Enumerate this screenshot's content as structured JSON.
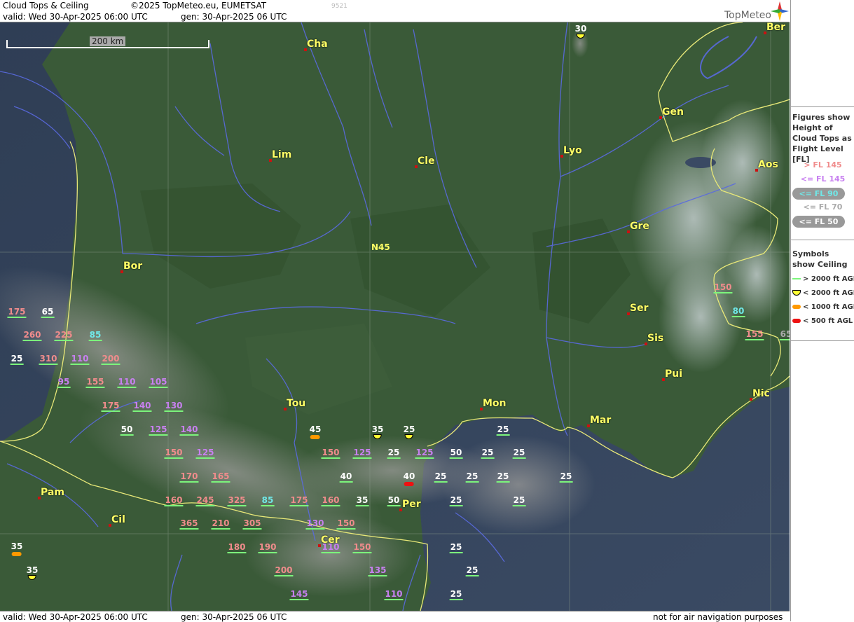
{
  "header": {
    "title": "Cloud Tops & Ceiling",
    "copyright": "©2025 TopMeteo.eu, EUMETSAT",
    "valid": "valid:  Wed  30-Apr-2025  06:00 UTC",
    "gen": "gen: 30-Apr-2025 06 UTC",
    "faint_code": "9521",
    "logo": "TopMeteo"
  },
  "footer": {
    "valid": "valid:  Wed  30-Apr-2025  06:00 UTC",
    "gen": "gen: 30-Apr-2025 06 UTC",
    "disclaimer": "not for air navigation purposes"
  },
  "scale": {
    "label": "200 km"
  },
  "lat_label": "N45",
  "legend": {
    "figures_title": "Figures show Height of Cloud Tops as Flight Level  [FL]",
    "figures": [
      {
        "label": "> FL 145",
        "color": "#f08c8c"
      },
      {
        "label": "<= FL 145",
        "color": "#c880f0"
      },
      {
        "label": "<= FL 90",
        "color": "#70e8e8"
      },
      {
        "label": "<= FL 70",
        "color": "#aaaaaa"
      },
      {
        "label": "<= FL 50",
        "color": "#ffffff"
      }
    ],
    "symbols_title": "Symbols show Ceiling",
    "symbols": [
      {
        "label": "> 2000 ft AGL",
        "color": "#7cf57c"
      },
      {
        "label": "< 2000 ft AGL",
        "color": "#ffff33"
      },
      {
        "label": "< 1000 ft AGL",
        "color": "#ff9900"
      },
      {
        "label": "< 500 ft AGL",
        "color": "#ee1111"
      }
    ]
  },
  "cities": [
    {
      "name": "Cha"
    },
    {
      "name": "Ber"
    },
    {
      "name": "Gen"
    },
    {
      "name": "Lim"
    },
    {
      "name": "Cle"
    },
    {
      "name": "Lyo"
    },
    {
      "name": "Aos"
    },
    {
      "name": "Gre"
    },
    {
      "name": "Bor"
    },
    {
      "name": "Ser"
    },
    {
      "name": "Sis"
    },
    {
      "name": "Pui"
    },
    {
      "name": "Nic"
    },
    {
      "name": "Tou"
    },
    {
      "name": "Mon"
    },
    {
      "name": "Mar"
    },
    {
      "name": "Pam"
    },
    {
      "name": "Per"
    },
    {
      "name": "Cil"
    },
    {
      "name": "Cer"
    }
  ],
  "figures": [
    {
      "v": "175",
      "c": "#f08c8c"
    },
    {
      "v": "65",
      "c": "#ffffff"
    },
    {
      "v": "260",
      "c": "#f08c8c"
    },
    {
      "v": "225",
      "c": "#f08c8c"
    },
    {
      "v": "85",
      "c": "#70e8e8"
    },
    {
      "v": "25",
      "c": "#ffffff"
    },
    {
      "v": "310",
      "c": "#f08c8c"
    },
    {
      "v": "110",
      "c": "#c880f0"
    },
    {
      "v": "200",
      "c": "#f08c8c"
    },
    {
      "v": "95",
      "c": "#c880f0"
    },
    {
      "v": "155",
      "c": "#f08c8c"
    },
    {
      "v": "110",
      "c": "#c880f0"
    },
    {
      "v": "105",
      "c": "#c880f0"
    },
    {
      "v": "175",
      "c": "#f08c8c"
    },
    {
      "v": "140",
      "c": "#c880f0"
    },
    {
      "v": "130",
      "c": "#c880f0"
    },
    {
      "v": "50",
      "c": "#ffffff"
    },
    {
      "v": "125",
      "c": "#c880f0"
    },
    {
      "v": "140",
      "c": "#c880f0"
    },
    {
      "v": "150",
      "c": "#f08c8c"
    },
    {
      "v": "125",
      "c": "#c880f0"
    },
    {
      "v": "170",
      "c": "#f08c8c"
    },
    {
      "v": "165",
      "c": "#f08c8c"
    },
    {
      "v": "160",
      "c": "#f08c8c"
    },
    {
      "v": "245",
      "c": "#f08c8c"
    },
    {
      "v": "325",
      "c": "#f08c8c"
    },
    {
      "v": "85",
      "c": "#70e8e8"
    },
    {
      "v": "175",
      "c": "#f08c8c"
    },
    {
      "v": "160",
      "c": "#f08c8c"
    },
    {
      "v": "365",
      "c": "#f08c8c"
    },
    {
      "v": "210",
      "c": "#f08c8c"
    },
    {
      "v": "305",
      "c": "#f08c8c"
    },
    {
      "v": "130",
      "c": "#c880f0"
    },
    {
      "v": "150",
      "c": "#f08c8c"
    },
    {
      "v": "180",
      "c": "#f08c8c"
    },
    {
      "v": "190",
      "c": "#f08c8c"
    },
    {
      "v": "110",
      "c": "#c880f0"
    },
    {
      "v": "150",
      "c": "#f08c8c"
    },
    {
      "v": "200",
      "c": "#f08c8c"
    },
    {
      "v": "135",
      "c": "#c880f0"
    },
    {
      "v": "145",
      "c": "#c880f0"
    },
    {
      "v": "110",
      "c": "#c880f0"
    },
    {
      "v": "150",
      "c": "#f08c8c"
    },
    {
      "v": "125",
      "c": "#c880f0"
    },
    {
      "v": "125",
      "c": "#c880f0"
    },
    {
      "v": "25",
      "c": "#ffffff"
    },
    {
      "v": "50",
      "c": "#ffffff"
    },
    {
      "v": "25",
      "c": "#ffffff"
    },
    {
      "v": "25",
      "c": "#ffffff"
    },
    {
      "v": "40",
      "c": "#ffffff"
    },
    {
      "v": "25",
      "c": "#ffffff"
    },
    {
      "v": "25",
      "c": "#ffffff"
    },
    {
      "v": "25",
      "c": "#ffffff"
    },
    {
      "v": "25",
      "c": "#ffffff"
    },
    {
      "v": "35",
      "c": "#ffffff"
    },
    {
      "v": "50",
      "c": "#ffffff"
    },
    {
      "v": "25",
      "c": "#ffffff"
    },
    {
      "v": "25",
      "c": "#ffffff"
    },
    {
      "v": "25",
      "c": "#ffffff"
    },
    {
      "v": "25",
      "c": "#ffffff"
    },
    {
      "v": "25",
      "c": "#ffffff"
    },
    {
      "v": "25",
      "c": "#ffffff"
    },
    {
      "v": "150",
      "c": "#f08c8c"
    },
    {
      "v": "80",
      "c": "#70e8e8"
    },
    {
      "v": "155",
      "c": "#f08c8c"
    },
    {
      "v": "65",
      "c": "#aaaaaa"
    }
  ],
  "symbols": [
    {
      "v": "30",
      "type": "yellow"
    },
    {
      "v": "45",
      "type": "orange"
    },
    {
      "v": "35",
      "type": "yellow"
    },
    {
      "v": "25",
      "type": "yellow"
    },
    {
      "v": "40",
      "type": "red"
    },
    {
      "v": "35",
      "type": "orange"
    },
    {
      "v": "35",
      "type": "yellow"
    }
  ]
}
